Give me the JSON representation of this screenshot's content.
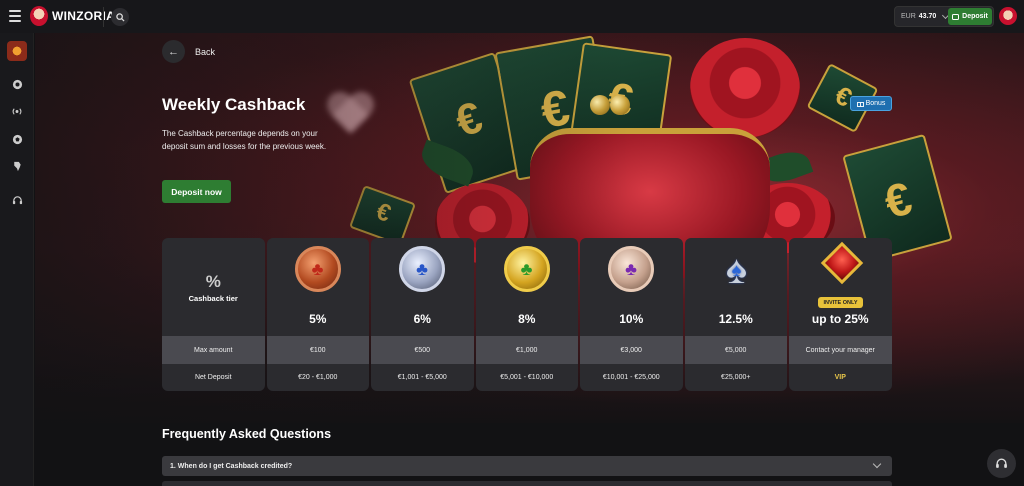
{
  "header": {
    "brand": "WINZORIA",
    "currency": "EUR",
    "balance": "43.70",
    "deposit_label": "Deposit"
  },
  "nav": {
    "back_label": "Back"
  },
  "hero": {
    "title": "Weekly Cashback",
    "description": "The Cashback percentage depends on your deposit sum and losses for the previous week.",
    "cta_label": "Deposit now",
    "bonus_badge": "Bonus"
  },
  "tiers": {
    "header_icon": "%",
    "header_label": "Cashback tier",
    "row1_label": "Max amount",
    "row2_label": "Net Deposit",
    "items": [
      {
        "icon": "bronze-coin",
        "percent": "5%",
        "max_amount": "€100",
        "net_deposit": "€20 - €1,000"
      },
      {
        "icon": "silver-coin",
        "percent": "6%",
        "max_amount": "€500",
        "net_deposit": "€1,001 - €5,000"
      },
      {
        "icon": "gold-coin",
        "percent": "8%",
        "max_amount": "€1,000",
        "net_deposit": "€5,001 - €10,000"
      },
      {
        "icon": "rose-gold-coin",
        "percent": "10%",
        "max_amount": "€3,000",
        "net_deposit": "€10,001 - €25,000"
      },
      {
        "icon": "spade-emblem",
        "percent": "12.5%",
        "max_amount": "€5,000",
        "net_deposit": "€25,000+"
      },
      {
        "icon": "diamond-emblem",
        "badge": "INVITE ONLY",
        "percent": "up to 25%",
        "max_amount": "Contact your manager",
        "net_deposit": "VIP"
      }
    ]
  },
  "faq": {
    "title": "Frequently Asked Questions",
    "items": [
      {
        "number": "1.",
        "question": "When do I get Cashback credited?"
      }
    ]
  },
  "colors": {
    "accent_green": "#2e7d32",
    "vip_gold": "#e8c64a",
    "bonus_blue": "#1e6fb0"
  }
}
